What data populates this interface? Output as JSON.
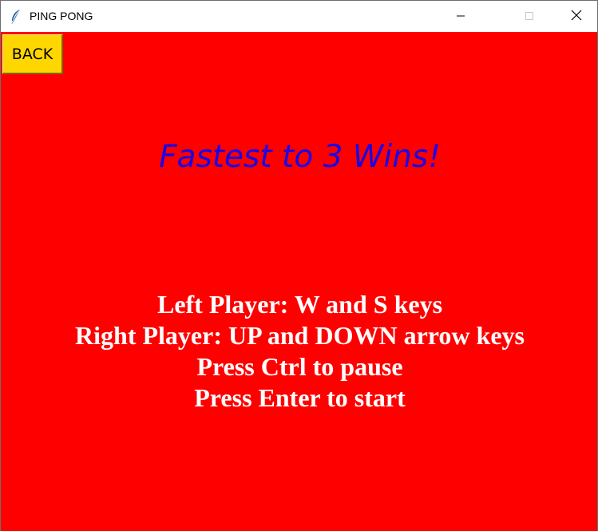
{
  "window": {
    "title": "PING PONG",
    "icon": "feather-icon",
    "controls": {
      "minimize_icon": "minimize-icon",
      "maximize_icon": "maximize-icon",
      "close_icon": "close-icon"
    }
  },
  "toolbar": {
    "back_label": "BACK"
  },
  "screen": {
    "headline": "Fastest to 3 Wins!",
    "instructions": [
      "Left Player: W and S keys",
      "Right Player: UP and DOWN arrow keys",
      "Press Ctrl to pause",
      "Press Enter to start"
    ]
  },
  "colors": {
    "background": "#ff0000",
    "back_button": "#ffd700",
    "headline": "#1a00e6",
    "instructions": "#ffffff"
  }
}
